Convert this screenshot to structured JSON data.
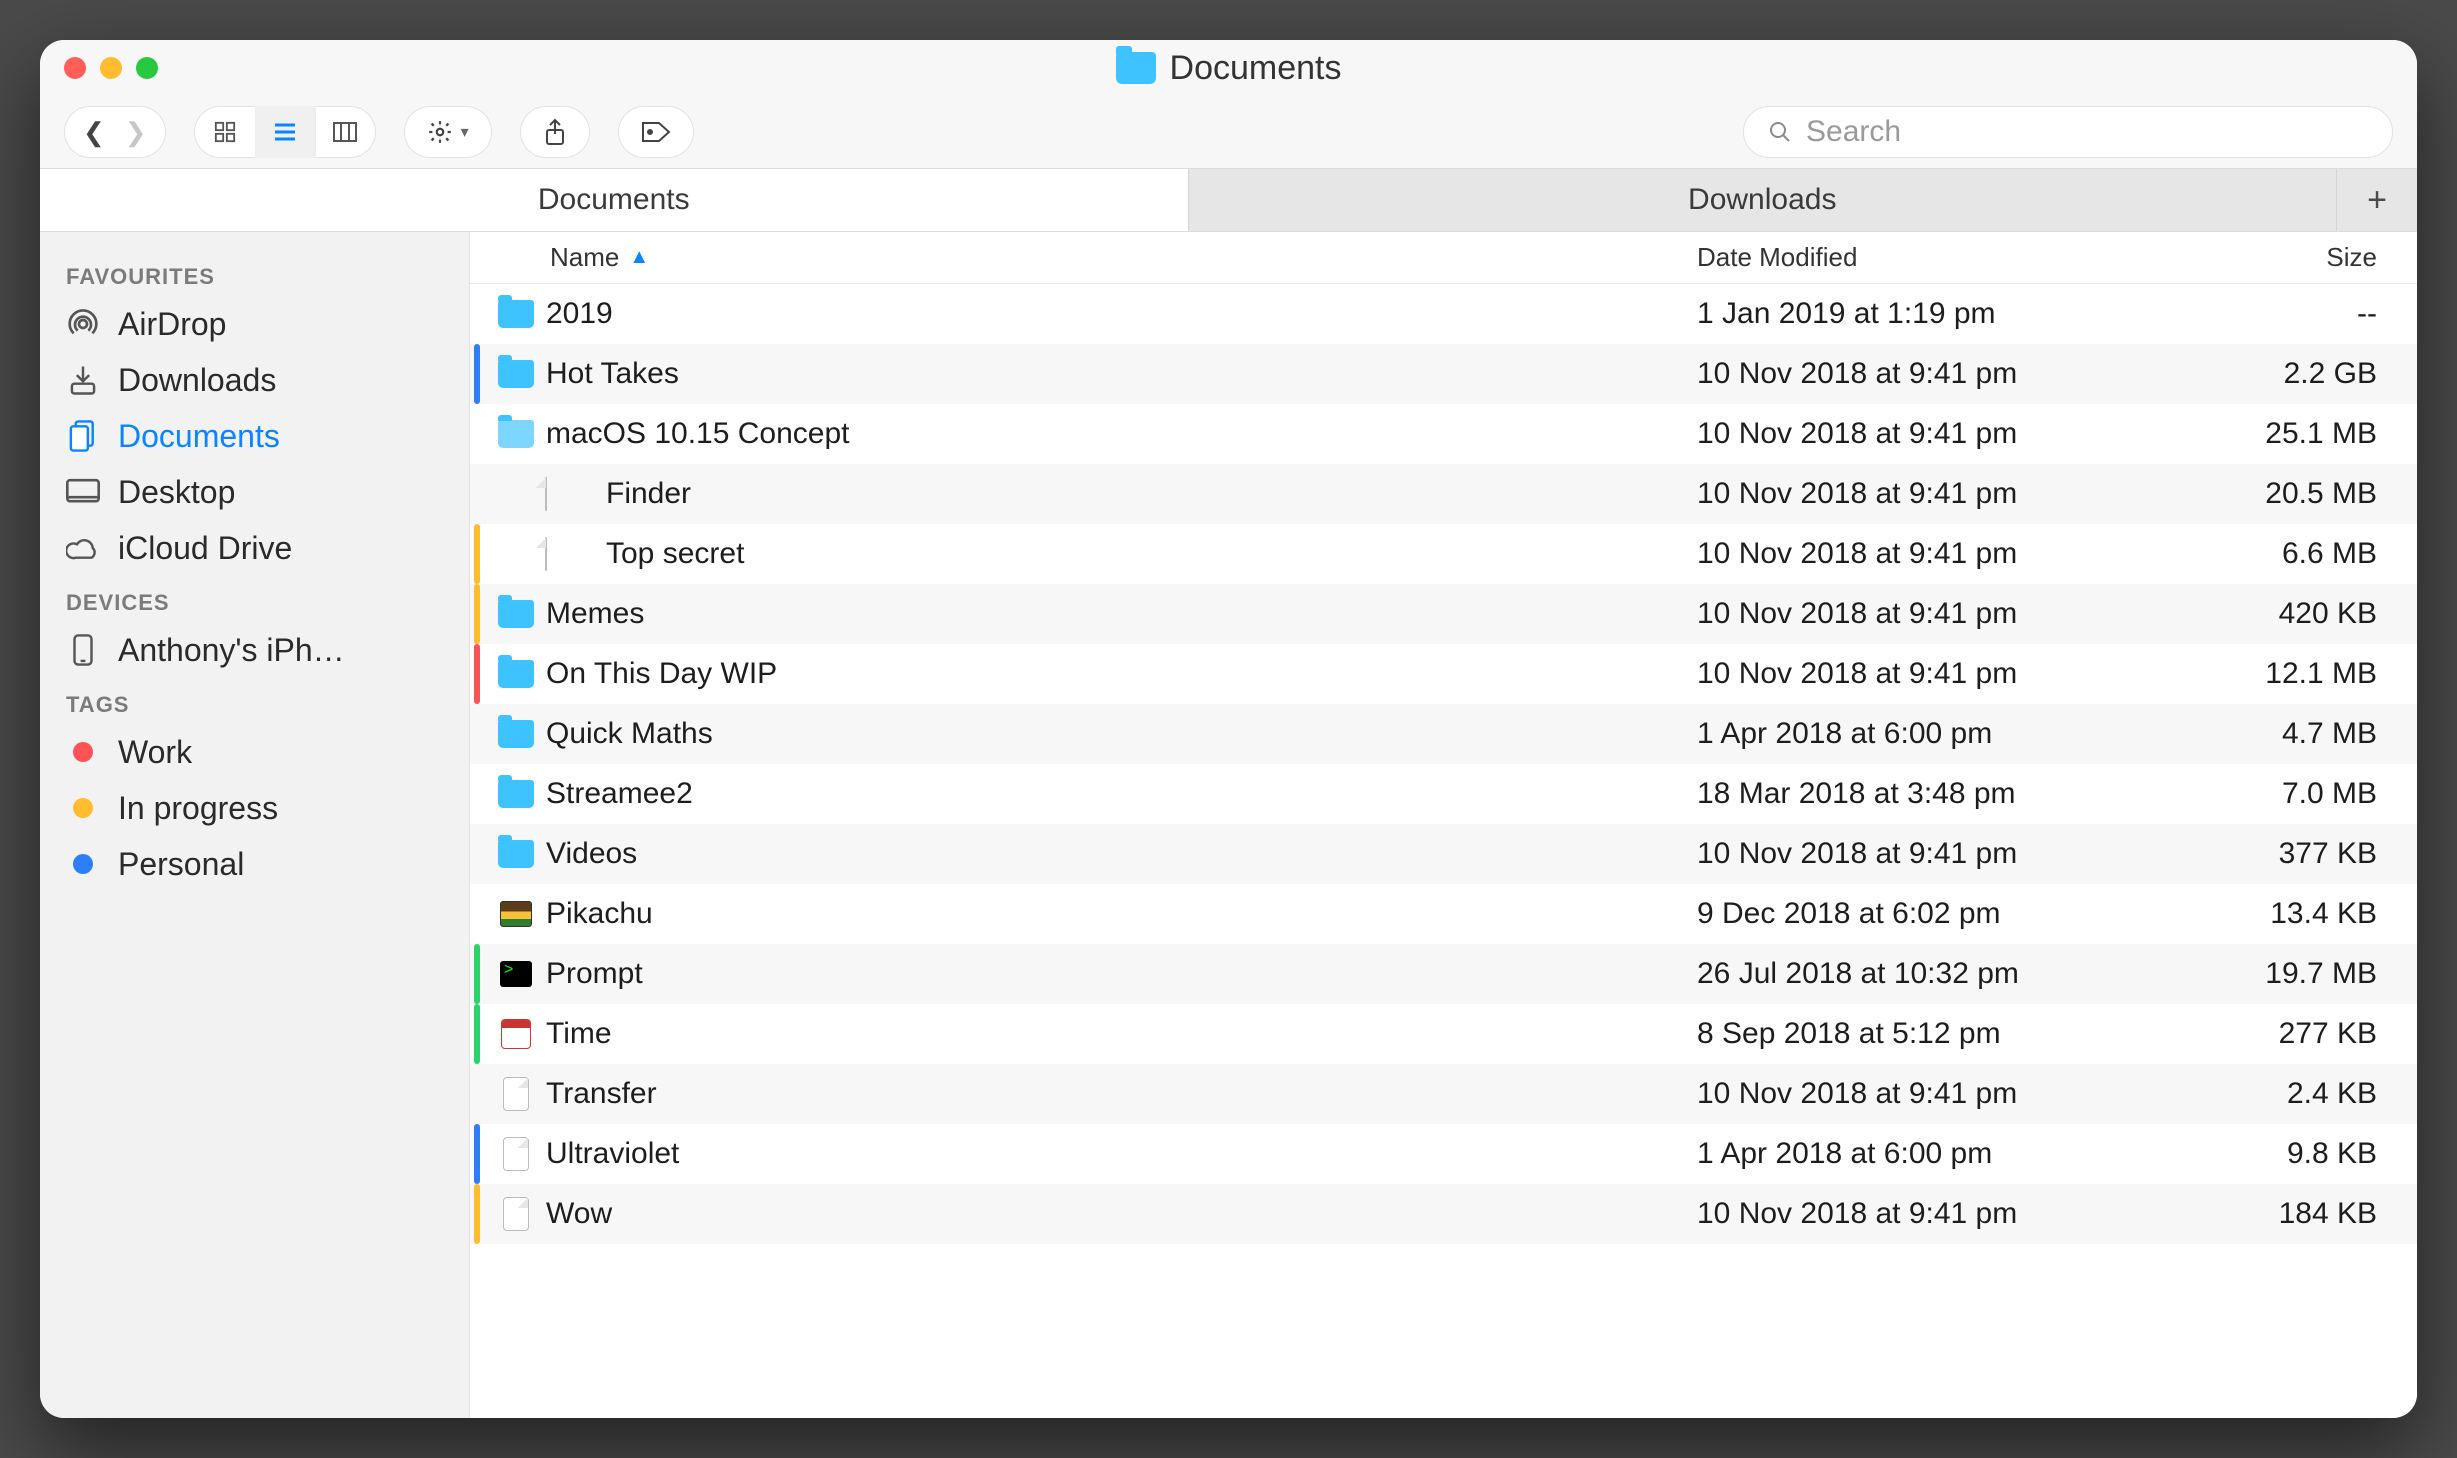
{
  "window": {
    "title": "Documents"
  },
  "search": {
    "placeholder": "Search"
  },
  "tabs": [
    {
      "label": "Documents",
      "active": true
    },
    {
      "label": "Downloads",
      "active": false
    }
  ],
  "columns": {
    "name": "Name",
    "date": "Date Modified",
    "size": "Size"
  },
  "sidebar": {
    "favourites_label": "FAVOURITES",
    "favourites": [
      {
        "label": "AirDrop",
        "icon": "airdrop"
      },
      {
        "label": "Downloads",
        "icon": "download"
      },
      {
        "label": "Documents",
        "icon": "documents",
        "selected": true
      },
      {
        "label": "Desktop",
        "icon": "desktop"
      },
      {
        "label": "iCloud Drive",
        "icon": "cloud"
      }
    ],
    "devices_label": "DEVICES",
    "devices": [
      {
        "label": "Anthony's iPh…",
        "icon": "phone"
      }
    ],
    "tags_label": "TAGS",
    "tags": [
      {
        "label": "Work",
        "color": "#ff5257"
      },
      {
        "label": "In progress",
        "color": "#ffbd2e"
      },
      {
        "label": "Personal",
        "color": "#2d7ff9"
      }
    ]
  },
  "files": [
    {
      "name": "2019",
      "kind": "folder",
      "date": "1 Jan 2019 at 1:19 pm",
      "size": "--",
      "tag": null,
      "indent": 0
    },
    {
      "name": "Hot Takes",
      "kind": "folder",
      "date": "10 Nov 2018 at 9:41 pm",
      "size": "2.2 GB",
      "tag": "#2d7ff9",
      "indent": 0
    },
    {
      "name": "macOS 10.15 Concept",
      "kind": "folder-open",
      "date": "10 Nov 2018 at 9:41 pm",
      "size": "25.1 MB",
      "tag": null,
      "indent": 0
    },
    {
      "name": "Finder",
      "kind": "doc",
      "date": "10 Nov 2018 at 9:41 pm",
      "size": "20.5 MB",
      "tag": null,
      "indent": 1
    },
    {
      "name": "Top secret",
      "kind": "doc",
      "date": "10 Nov 2018 at 9:41 pm",
      "size": "6.6 MB",
      "tag": "#ffbd2e",
      "indent": 1
    },
    {
      "name": "Memes",
      "kind": "folder",
      "date": "10 Nov 2018 at 9:41 pm",
      "size": "420 KB",
      "tag": "#ffbd2e",
      "indent": 0
    },
    {
      "name": "On This Day WIP",
      "kind": "folder",
      "date": "10 Nov 2018 at 9:41 pm",
      "size": "12.1 MB",
      "tag": "#ff5257",
      "indent": 0
    },
    {
      "name": "Quick Maths",
      "kind": "folder",
      "date": "1 Apr 2018 at 6:00 pm",
      "size": "4.7 MB",
      "tag": null,
      "indent": 0
    },
    {
      "name": "Streamee2",
      "kind": "folder",
      "date": "18 Mar 2018 at 3:48 pm",
      "size": "7.0 MB",
      "tag": null,
      "indent": 0
    },
    {
      "name": "Videos",
      "kind": "folder",
      "date": "10 Nov 2018 at 9:41 pm",
      "size": "377 KB",
      "tag": null,
      "indent": 0
    },
    {
      "name": "Pikachu",
      "kind": "img",
      "date": "9 Dec 2018 at 6:02 pm",
      "size": "13.4 KB",
      "tag": null,
      "indent": 0
    },
    {
      "name": "Prompt",
      "kind": "term",
      "date": "26 Jul 2018 at 10:32 pm",
      "size": "19.7 MB",
      "tag": "#2bd46a",
      "indent": 0
    },
    {
      "name": "Time",
      "kind": "cal",
      "date": "8 Sep 2018 at 5:12 pm",
      "size": "277 KB",
      "tag": "#2bd46a",
      "indent": 0
    },
    {
      "name": "Transfer",
      "kind": "doc",
      "date": "10 Nov 2018 at 9:41 pm",
      "size": "2.4 KB",
      "tag": null,
      "indent": 0
    },
    {
      "name": "Ultraviolet",
      "kind": "doc",
      "date": "1 Apr 2018 at 6:00 pm",
      "size": "9.8 KB",
      "tag": "#2d7ff9",
      "indent": 0
    },
    {
      "name": "Wow",
      "kind": "doc",
      "date": "10 Nov 2018 at 9:41 pm",
      "size": "184 KB",
      "tag": "#ffbd2e",
      "indent": 0
    }
  ]
}
